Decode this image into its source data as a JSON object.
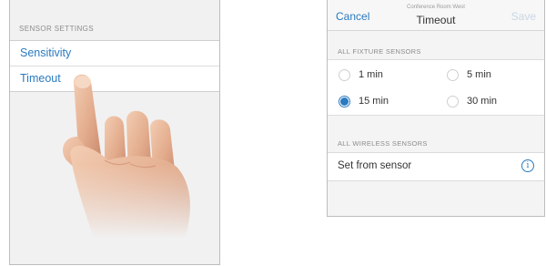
{
  "left_screen": {
    "section_header": "SENSOR SETTINGS",
    "items": [
      {
        "label": "Sensitivity"
      },
      {
        "label": "Timeout"
      }
    ]
  },
  "right_screen": {
    "nav": {
      "cancel_label": "Cancel",
      "subtitle": "Conference Room West",
      "title": "Timeout",
      "save_label": "Save"
    },
    "fixture_section_header": "ALL FIXTURE SENSORS",
    "options": [
      {
        "label": "1 min",
        "selected": false
      },
      {
        "label": "5 min",
        "selected": false
      },
      {
        "label": "15 min",
        "selected": true
      },
      {
        "label": "30 min",
        "selected": false
      }
    ],
    "wireless_section_header": "ALL WIRELESS SENSORS",
    "wireless_row": {
      "label": "Set from sensor",
      "icon": "info-icon"
    }
  },
  "colors": {
    "accent": "#2a7ac0",
    "disabled": "#c9d6e4",
    "background": "#f1f1f1"
  }
}
